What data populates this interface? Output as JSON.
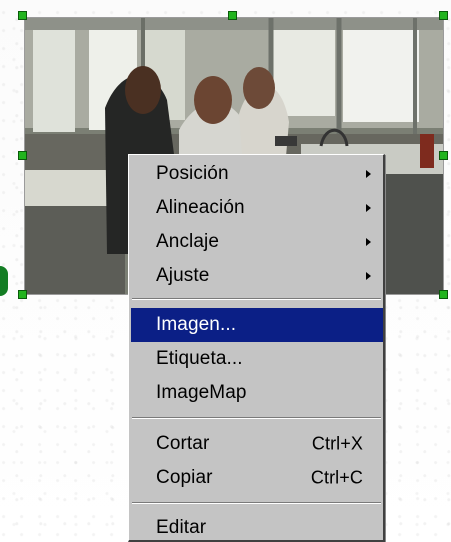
{
  "menu": {
    "items": [
      {
        "label": "Posición",
        "has_submenu": true
      },
      {
        "label": "Alineación",
        "has_submenu": true
      },
      {
        "label": "Anclaje",
        "has_submenu": true
      },
      {
        "label": "Ajuste",
        "has_submenu": true
      },
      {
        "label": "Imagen...",
        "selected": true
      },
      {
        "label": "Etiqueta..."
      },
      {
        "label": "ImageMap"
      },
      {
        "label": "Cortar",
        "shortcut": "Ctrl+X"
      },
      {
        "label": "Copiar",
        "shortcut": "Ctrl+C"
      },
      {
        "label": "Editar"
      }
    ]
  },
  "colors": {
    "selection_highlight": "#0b1f86",
    "menu_background": "#c4c4c4",
    "resize_handle": "#22b41e"
  },
  "icons": {
    "submenu_arrow": "submenu-arrow-icon",
    "resize_handle": "resize-handle-icon"
  }
}
